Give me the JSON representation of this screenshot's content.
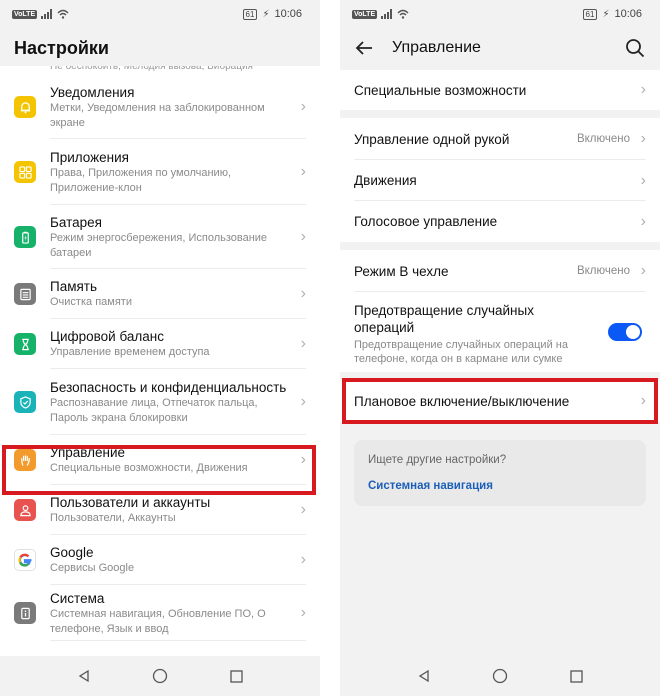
{
  "status": {
    "time": "10:06",
    "battery": "61",
    "volte": "VoLTE"
  },
  "left": {
    "title": "Настройки",
    "faded_row": "Не беспокоить, Мелодия вызова, Вибрация",
    "items": [
      {
        "title": "Уведомления",
        "sub": "Метки, Уведомления на заблокированном экране",
        "color": "#f5c400",
        "icon": "bell-icon"
      },
      {
        "title": "Приложения",
        "sub": "Права, Приложения по умолчанию, Приложение-клон",
        "color": "#f5c400",
        "icon": "apps-grid-icon"
      },
      {
        "title": "Батарея",
        "sub": "Режим энергосбережения, Использование батареи",
        "color": "#17b26a",
        "icon": "battery-icon"
      },
      {
        "title": "Память",
        "sub": "Очистка памяти",
        "color": "#7a7a7a",
        "icon": "storage-icon"
      },
      {
        "title": "Цифровой баланс",
        "sub": "Управление временем доступа",
        "color": "#17b26a",
        "icon": "hourglass-icon"
      },
      {
        "title": "Безопасность и конфиденциальность",
        "sub": "Распознавание лица, Отпечаток пальца, Пароль экрана блокировки",
        "color": "#19b3b8",
        "icon": "shield-icon"
      },
      {
        "title": "Управление",
        "sub": "Специальные возможности, Движения",
        "color": "#f29b2c",
        "icon": "hand-icon"
      },
      {
        "title": "Пользователи и аккаунты",
        "sub": "Пользователи, Аккаунты",
        "color": "#e8534f",
        "icon": "user-icon"
      },
      {
        "title": "Google",
        "sub": "Сервисы Google",
        "color": "#ffffff",
        "icon": "google-icon"
      },
      {
        "title": "Система",
        "sub": "Системная навигация, Обновление ПО, О телефоне, Язык и ввод",
        "color": "#7a7a7a",
        "icon": "info-icon"
      }
    ]
  },
  "right": {
    "title": "Управление",
    "accessibility": "Специальные возможности",
    "one_hand": {
      "label": "Управление одной рукой",
      "value": "Включено"
    },
    "motions": "Движения",
    "voice": "Голосовое управление",
    "cover": {
      "label": "Режим В чехле",
      "value": "Включено"
    },
    "accidental": {
      "label": "Предотвращение случайных операций",
      "sub": "Предотвращение случайных операций на телефоне, когда он в кармане или сумке"
    },
    "scheduled": "Плановое включение/выключение",
    "hint": {
      "question": "Ищете другие настройки?",
      "link": "Системная навигация"
    }
  },
  "colors": {
    "highlight": "#d71920",
    "toggle": "#0a59f7",
    "link": "#1b5fb9"
  }
}
